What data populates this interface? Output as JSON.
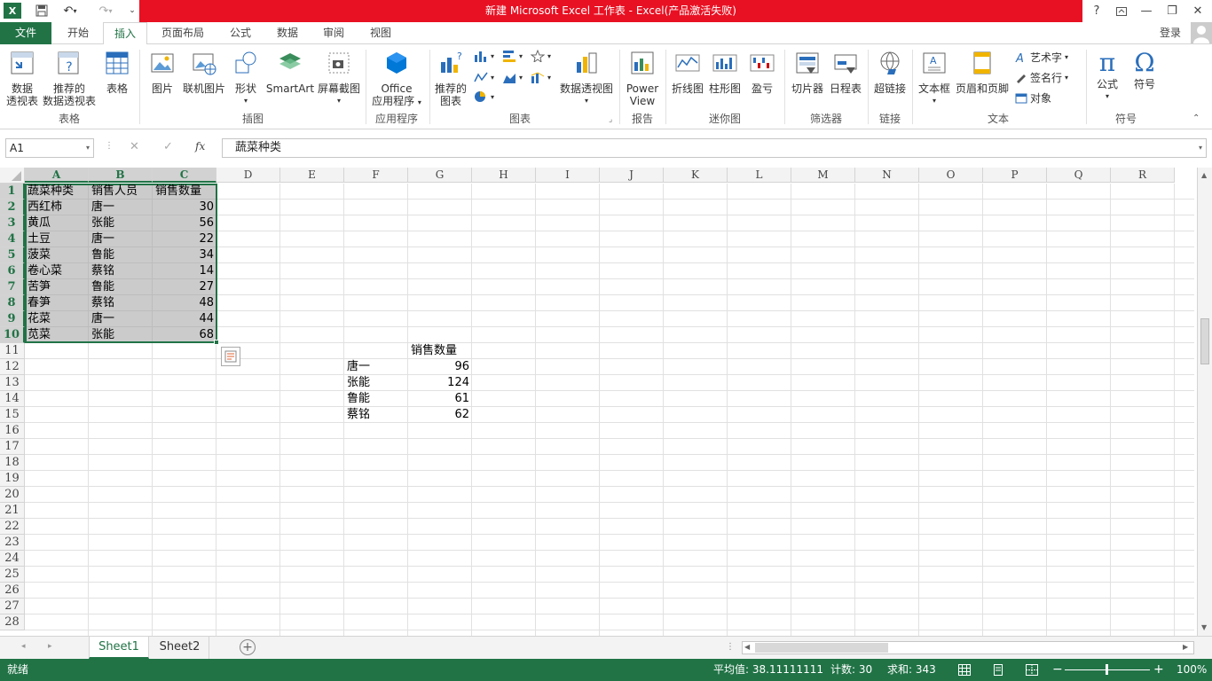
{
  "window": {
    "title": "新建 Microsoft Excel 工作表 -  Excel(产品激活失败)",
    "help": "?",
    "login": "登录"
  },
  "tabs": [
    {
      "label": "文件"
    },
    {
      "label": "开始"
    },
    {
      "label": "插入"
    },
    {
      "label": "页面布局"
    },
    {
      "label": "公式"
    },
    {
      "label": "数据"
    },
    {
      "label": "审阅"
    },
    {
      "label": "视图"
    }
  ],
  "ribbon": {
    "pivot_line1": "数据",
    "pivot_line2": "透视表",
    "rec_pivot_line1": "推荐的",
    "rec_pivot_line2": "数据透视表",
    "table": "表格",
    "picture": "图片",
    "online_picture": "联机图片",
    "shapes": "形状",
    "smartart": "SmartArt",
    "screenshot": "屏幕截图",
    "office_line1": "Office",
    "office_line2": "应用程序",
    "rec_chart_line1": "推荐的",
    "rec_chart_line2": "图表",
    "pivot_chart": "数据透视图",
    "power_line1": "Power",
    "power_line2": "View",
    "spark_line": "折线图",
    "spark_col": "柱形图",
    "spark_wl": "盈亏",
    "slicer": "切片器",
    "timeline": "日程表",
    "hyperlink": "超链接",
    "textbox": "文本框",
    "header_footer": "页眉和页脚",
    "wordart": "艺术字",
    "signature": "签名行",
    "object": "对象",
    "equation": "公式",
    "symbol": "符号",
    "groups": {
      "tables": "表格",
      "illustrations": "插图",
      "apps": "应用程序",
      "charts": "图表",
      "reports": "报告",
      "sparklines": "迷你图",
      "filters": "筛选器",
      "links": "链接",
      "text": "文本",
      "symbols": "符号"
    }
  },
  "formula_bar": {
    "name_box": "A1",
    "fx": "fx",
    "content": "蔬菜种类"
  },
  "columns": [
    "A",
    "B",
    "C",
    "D",
    "E",
    "F",
    "G",
    "H",
    "I",
    "J",
    "K",
    "L",
    "M",
    "N",
    "O",
    "P",
    "Q",
    "R"
  ],
  "rows": [
    "1",
    "2",
    "3",
    "4",
    "5",
    "6",
    "7",
    "8",
    "9",
    "10",
    "11",
    "12",
    "13",
    "14",
    "15",
    "16",
    "17",
    "18",
    "19",
    "20",
    "21",
    "22",
    "23",
    "24",
    "25",
    "26",
    "27",
    "28"
  ],
  "table": {
    "headers": [
      "蔬菜种类",
      "销售人员",
      "销售数量"
    ],
    "rows": [
      [
        "西红柿",
        "唐一",
        "30"
      ],
      [
        "黄瓜",
        "张能",
        "56"
      ],
      [
        "土豆",
        "唐一",
        "22"
      ],
      [
        "菠菜",
        "鲁能",
        "34"
      ],
      [
        "卷心菜",
        "蔡铭",
        "14"
      ],
      [
        "苦笋",
        "鲁能",
        "27"
      ],
      [
        "春笋",
        "蔡铭",
        "48"
      ],
      [
        "花菜",
        "唐一",
        "44"
      ],
      [
        "苋菜",
        "张能",
        "68"
      ]
    ]
  },
  "summary": {
    "header": "销售数量",
    "rows": [
      [
        "唐一",
        "96"
      ],
      [
        "张能",
        "124"
      ],
      [
        "鲁能",
        "61"
      ],
      [
        "蔡铭",
        "62"
      ]
    ]
  },
  "sheets": [
    {
      "label": "Sheet1",
      "active": true
    },
    {
      "label": "Sheet2",
      "active": false
    }
  ],
  "status": {
    "mode": "就绪",
    "average": "平均值: 38.11111111",
    "count": "计数: 30",
    "sum": "求和: 343",
    "zoom": "100%"
  },
  "colors": {
    "excel_green": "#217346",
    "title_red": "#e81123"
  }
}
